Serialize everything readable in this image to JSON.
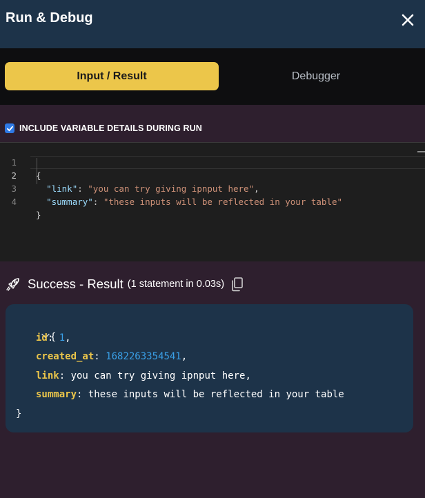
{
  "header": {
    "title": "Run & Debug",
    "close_icon": "close-icon"
  },
  "tabs": [
    {
      "label": "Input / Result",
      "active": true
    },
    {
      "label": "Debugger",
      "active": false
    }
  ],
  "options": {
    "include_variable_details_label": "INCLUDE VARIABLE DETAILS DURING RUN",
    "include_variable_details_checked": true
  },
  "editor": {
    "active_line": 2,
    "lines": [
      {
        "n": "1",
        "open": "{"
      },
      {
        "n": "2",
        "key": "\"link\"",
        "value": "\"you can try giving ipnput here\"",
        "trail": ","
      },
      {
        "n": "3",
        "key": "\"summary\"",
        "value": "\"these inputs will be reflected in your table\"",
        "trail": ""
      },
      {
        "n": "4",
        "close": "}"
      }
    ]
  },
  "result": {
    "icon": "rocket-icon",
    "title": "Success - Result",
    "subtitle": "(1 statement in 0.03s)",
    "copy_icon": "copy-icon",
    "collapse_icon": "chevron-down-icon",
    "open_brace": "{",
    "close_brace": "}",
    "fields": [
      {
        "key": "id",
        "value": "1",
        "type": "number",
        "trail": ","
      },
      {
        "key": "created_at",
        "value": "1682263354541",
        "type": "number",
        "trail": ","
      },
      {
        "key": "link",
        "value": "you can try giving ipnput here",
        "type": "text",
        "trail": ","
      },
      {
        "key": "summary",
        "value": "these inputs will be reflected in your table",
        "type": "text",
        "trail": ""
      }
    ]
  },
  "colors": {
    "header_bg": "#1d3349",
    "tab_active_bg": "#ecc64a",
    "checkbox": "#2f7ae5",
    "result_key": "#ecc64a",
    "result_number": "#3aa0e8"
  }
}
